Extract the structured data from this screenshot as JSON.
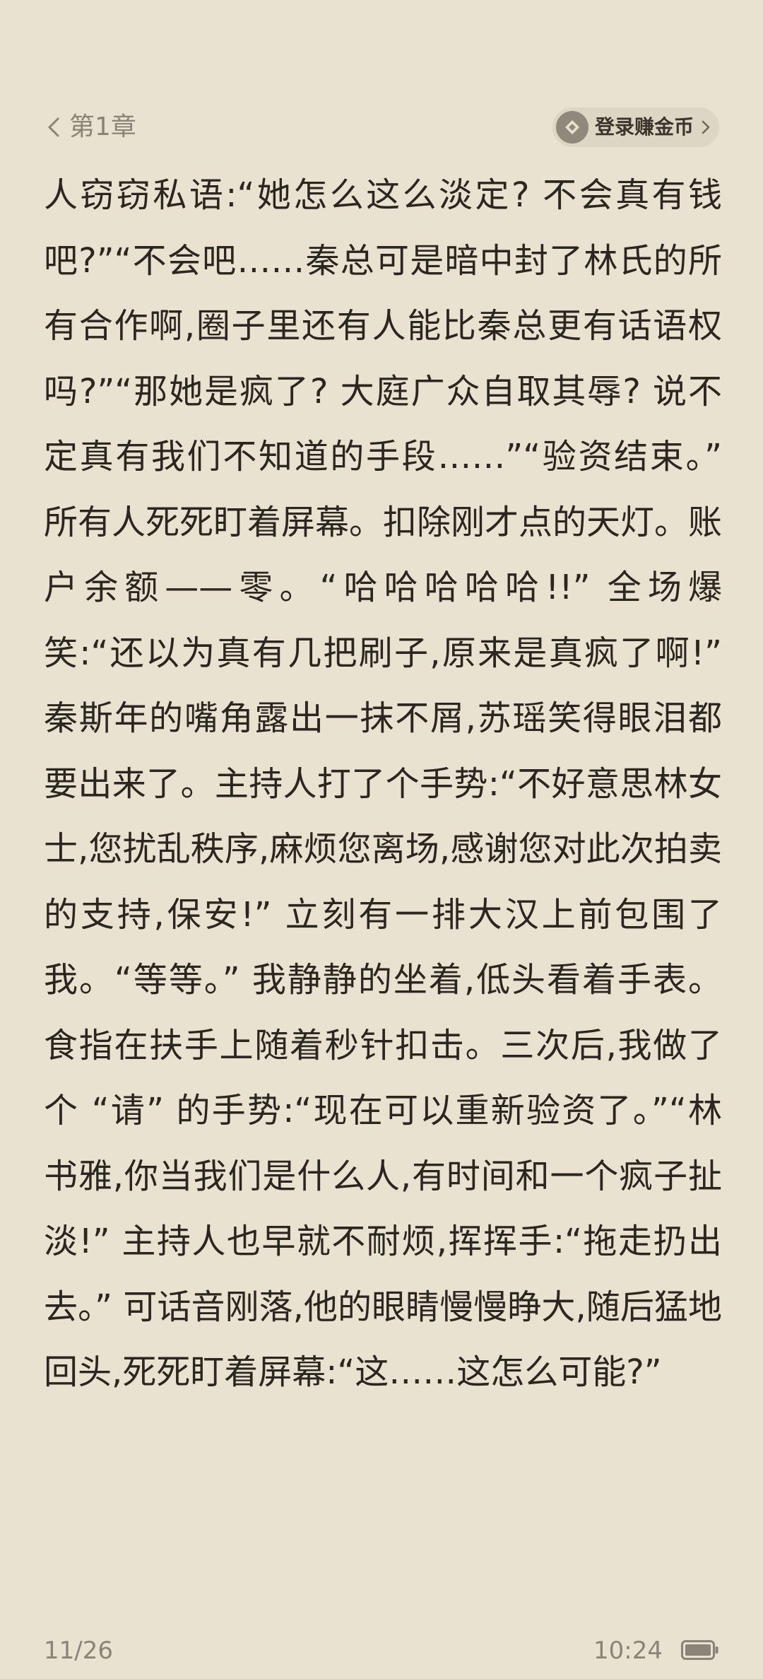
{
  "header": {
    "chapter_title": "第1章",
    "coin_button_label": "登录赚金币"
  },
  "content": {
    "body_text": "人窃窃私语:“她怎么这么淡定? 不会真有钱吧?”“不会吧……秦总可是暗中封了林氏的所有合作啊,圈子里还有人能比秦总更有话语权吗?”“那她是疯了? 大庭广众自取其辱? 说不定真有我们不知道的手段……”“验资结束。” 所有人死死盯着屏幕。扣除刚才点的天灯。账户余额——零。“哈哈哈哈哈!!” 全场爆笑:“还以为真有几把刷子,原来是真疯了啊!” 秦斯年的嘴角露出一抹不屑,苏瑶笑得眼泪都要出来了。主持人打了个手势:“不好意思林女士,您扰乱秩序,麻烦您离场,感谢您对此次拍卖的支持,保安!” 立刻有一排大汉上前包围了我。“等等。” 我静静的坐着,低头看着手表。食指在扶手上随着秒针扣击。三次后,我做了个 “请” 的手势:“现在可以重新验资了。”“林书雅,你当我们是什么人,有时间和一个疯子扯淡!” 主持人也早就不耐烦,挥挥手:“拖走扔出去。” 可话音刚落,他的眼睛慢慢睁大,随后猛地回头,死死盯着屏幕:“这……这怎么可能?”"
  },
  "footer": {
    "page_indicator": "11/26",
    "clock": "10:24"
  },
  "icons": {
    "back": "chevron-left-icon",
    "coin": "coin-icon",
    "battery": "battery-icon"
  },
  "colors": {
    "background": "#e9e2d0",
    "text": "#2b2620",
    "muted": "#8a8478",
    "pill": "#dcd6c5"
  }
}
